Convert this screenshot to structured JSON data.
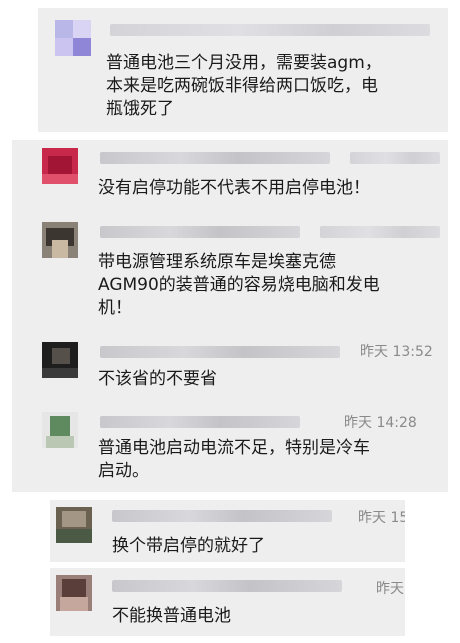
{
  "comments": [
    {
      "text_lines": [
        "普通电池三个月没用，需要装agm，",
        "本来是吃两碗饭非得给两口饭吃，电",
        "瓶饿死了"
      ],
      "time": ""
    },
    {
      "text_lines": [
        "没有启停功能不代表不用启停电池！"
      ],
      "time": ""
    },
    {
      "text_lines": [
        "带电源管理系统原车是埃塞克德",
        "AGM90的装普通的容易烧电脑和发电",
        "机！"
      ],
      "time": ""
    },
    {
      "text_lines": [
        "不该省的不要省"
      ],
      "time": "昨天 13:52"
    },
    {
      "text_lines": [
        "普通电池启动电流不足，特别是冷车",
        "启动。"
      ],
      "time": "昨天 14:28"
    },
    {
      "text_lines": [
        "换个带启停的就好了"
      ],
      "time": "昨天 15"
    },
    {
      "text_lines": [
        "不能换普通电池"
      ],
      "time": "昨天"
    }
  ],
  "colors": {
    "panel_bg": "#eeeeee",
    "text": "#1a1a1a",
    "timestamp": "#8a8a8a"
  }
}
